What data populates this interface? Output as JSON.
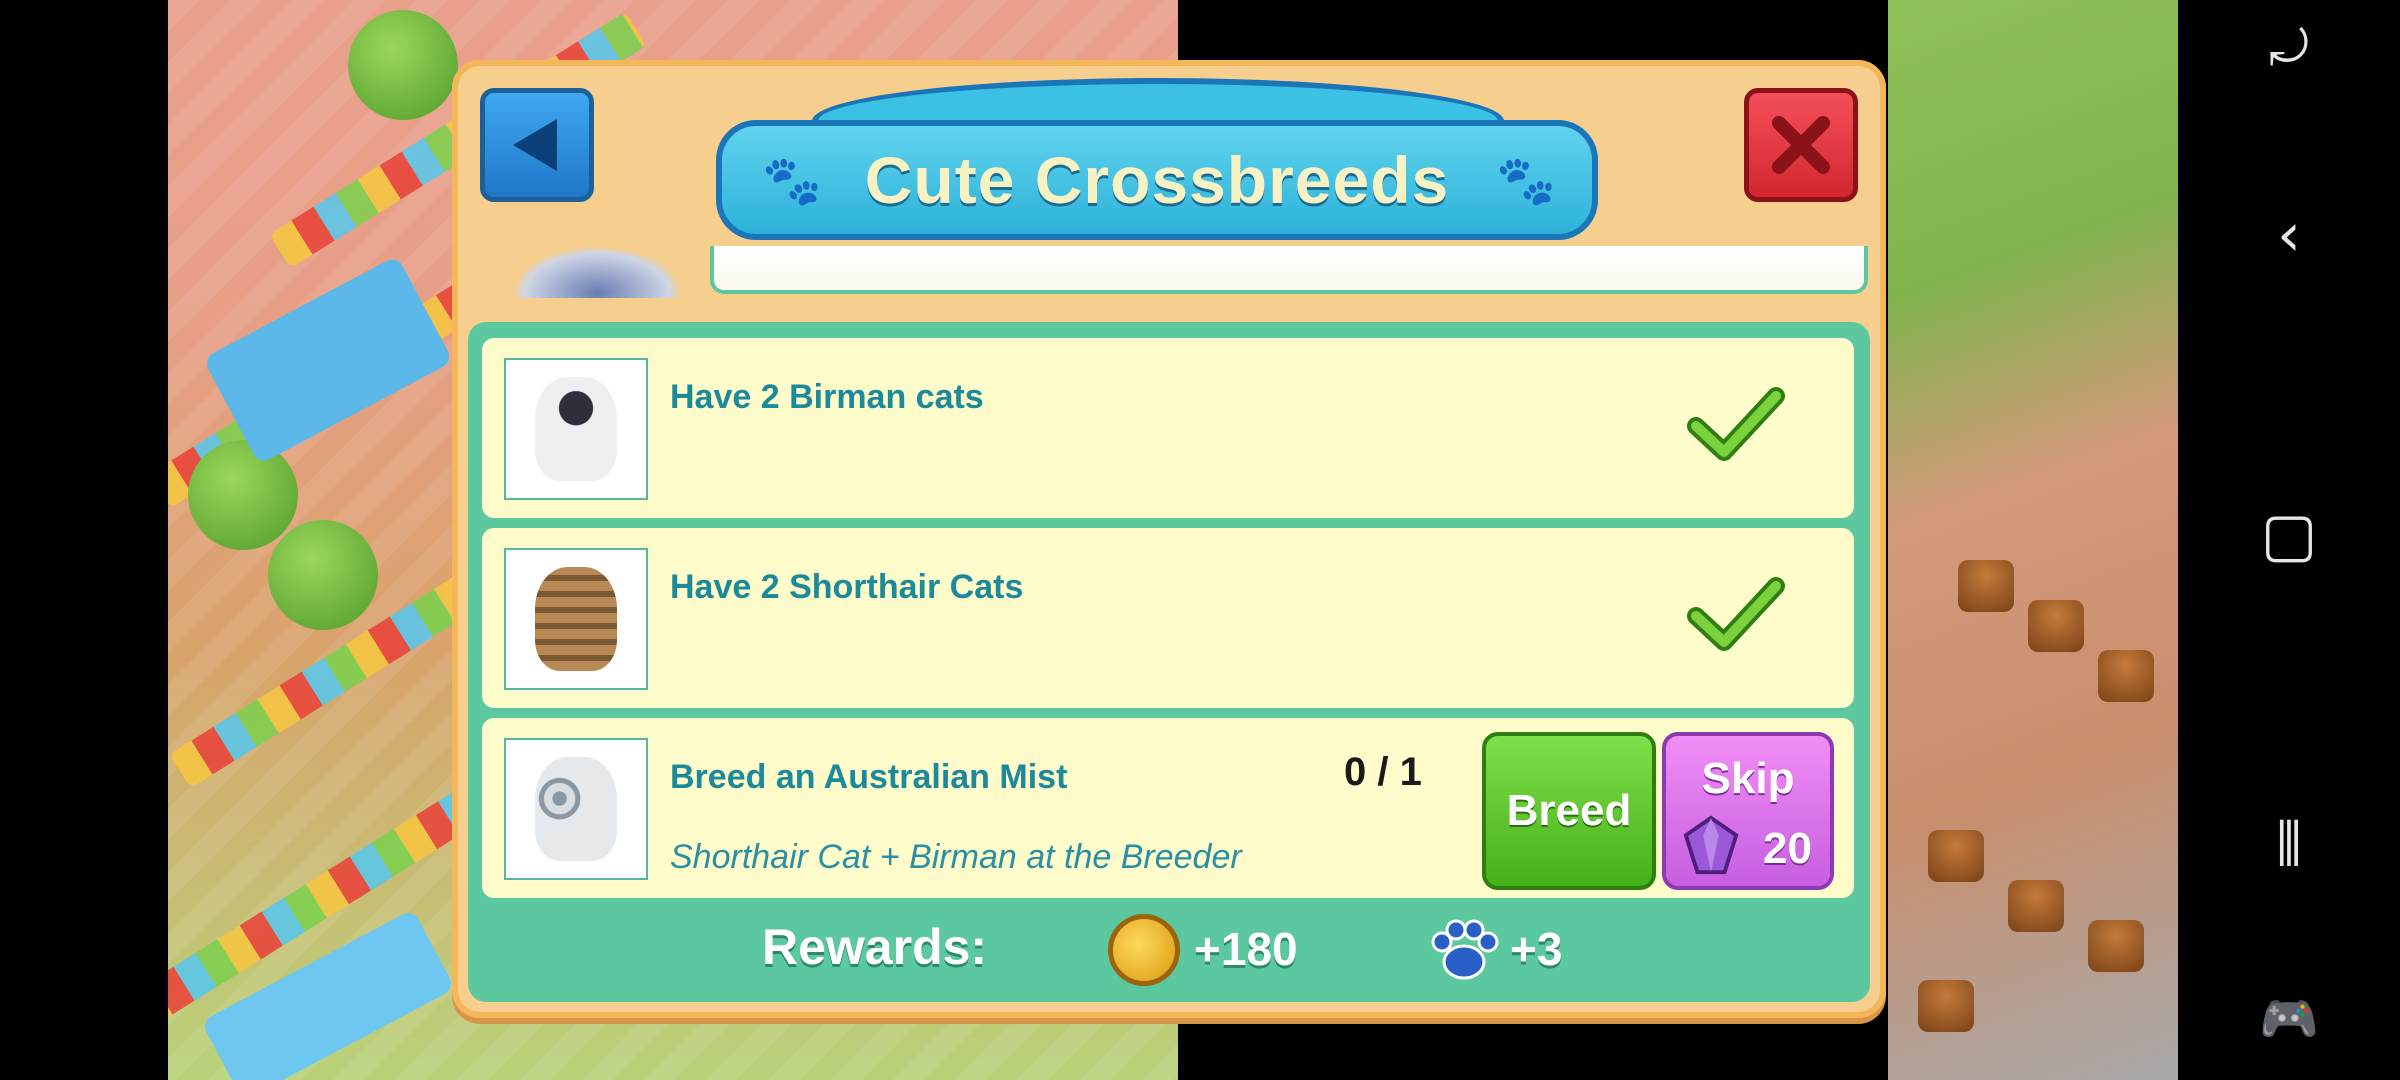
{
  "dialog": {
    "title": "Cute Crossbreeds",
    "back_icon": "back-arrow-icon",
    "close_icon": "close-icon"
  },
  "tasks": [
    {
      "title": "Have 2 Birman cats",
      "status": "complete",
      "thumb_icon": "birman-cat-icon"
    },
    {
      "title": "Have 2 Shorthair Cats",
      "status": "complete",
      "thumb_icon": "shorthair-cat-icon"
    },
    {
      "title": "Breed an Australian Mist",
      "progress": "0 / 1",
      "hint": "Shorthair Cat + Birman at the Breeder",
      "thumb_icon": "australian-mist-cat-icon",
      "breed_label": "Breed",
      "skip_label": "Skip",
      "skip_cost": "20"
    }
  ],
  "rewards": {
    "label": "Rewards:",
    "coins": "+180",
    "paw_points": "+3"
  },
  "colors": {
    "dialog_bg": "#f6cf8e",
    "panel_bg": "#5cc8a0",
    "title_bar": "#2db2d9",
    "breed_btn": "#46b019",
    "skip_btn": "#c75ee0"
  }
}
